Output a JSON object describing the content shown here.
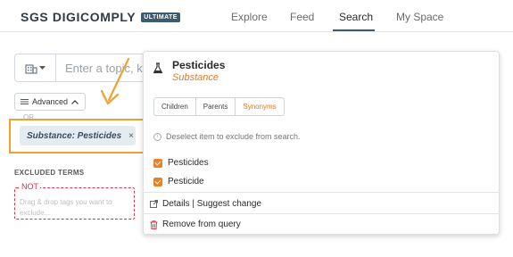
{
  "header": {
    "logo_text": "SGS DIGICOMPLY",
    "logo_badge": "ULTIMATE",
    "nav": {
      "explore": "Explore",
      "feed": "Feed",
      "search": "Search",
      "myspace": "My Space"
    },
    "active_tab": "Search"
  },
  "search": {
    "placeholder": "Enter a topic, k"
  },
  "advanced_label": "Advanced",
  "or_label": "OR",
  "tag": {
    "label": "Substance:  Pesticides",
    "close": "×"
  },
  "excluded": {
    "title": "EXCLUDED TERMS",
    "not_label": "NOT",
    "hint": "Drag & drop tags you want to exclude..."
  },
  "popup": {
    "title": "Pesticides",
    "subtitle": "Substance",
    "tabs": [
      "Children",
      "Parents",
      "Synonyms"
    ],
    "active_tab": "Synonyms",
    "info": "Deselect item to exclude from search.",
    "synonyms": [
      "Pesticides",
      "Pesticide"
    ],
    "details_action": "Details | Suggest change",
    "remove_action": "Remove from query"
  },
  "colors": {
    "accent": "#e8822a",
    "highlight": "#f0a030",
    "brand": "#3c5a70",
    "exclude": "#d8344a"
  }
}
